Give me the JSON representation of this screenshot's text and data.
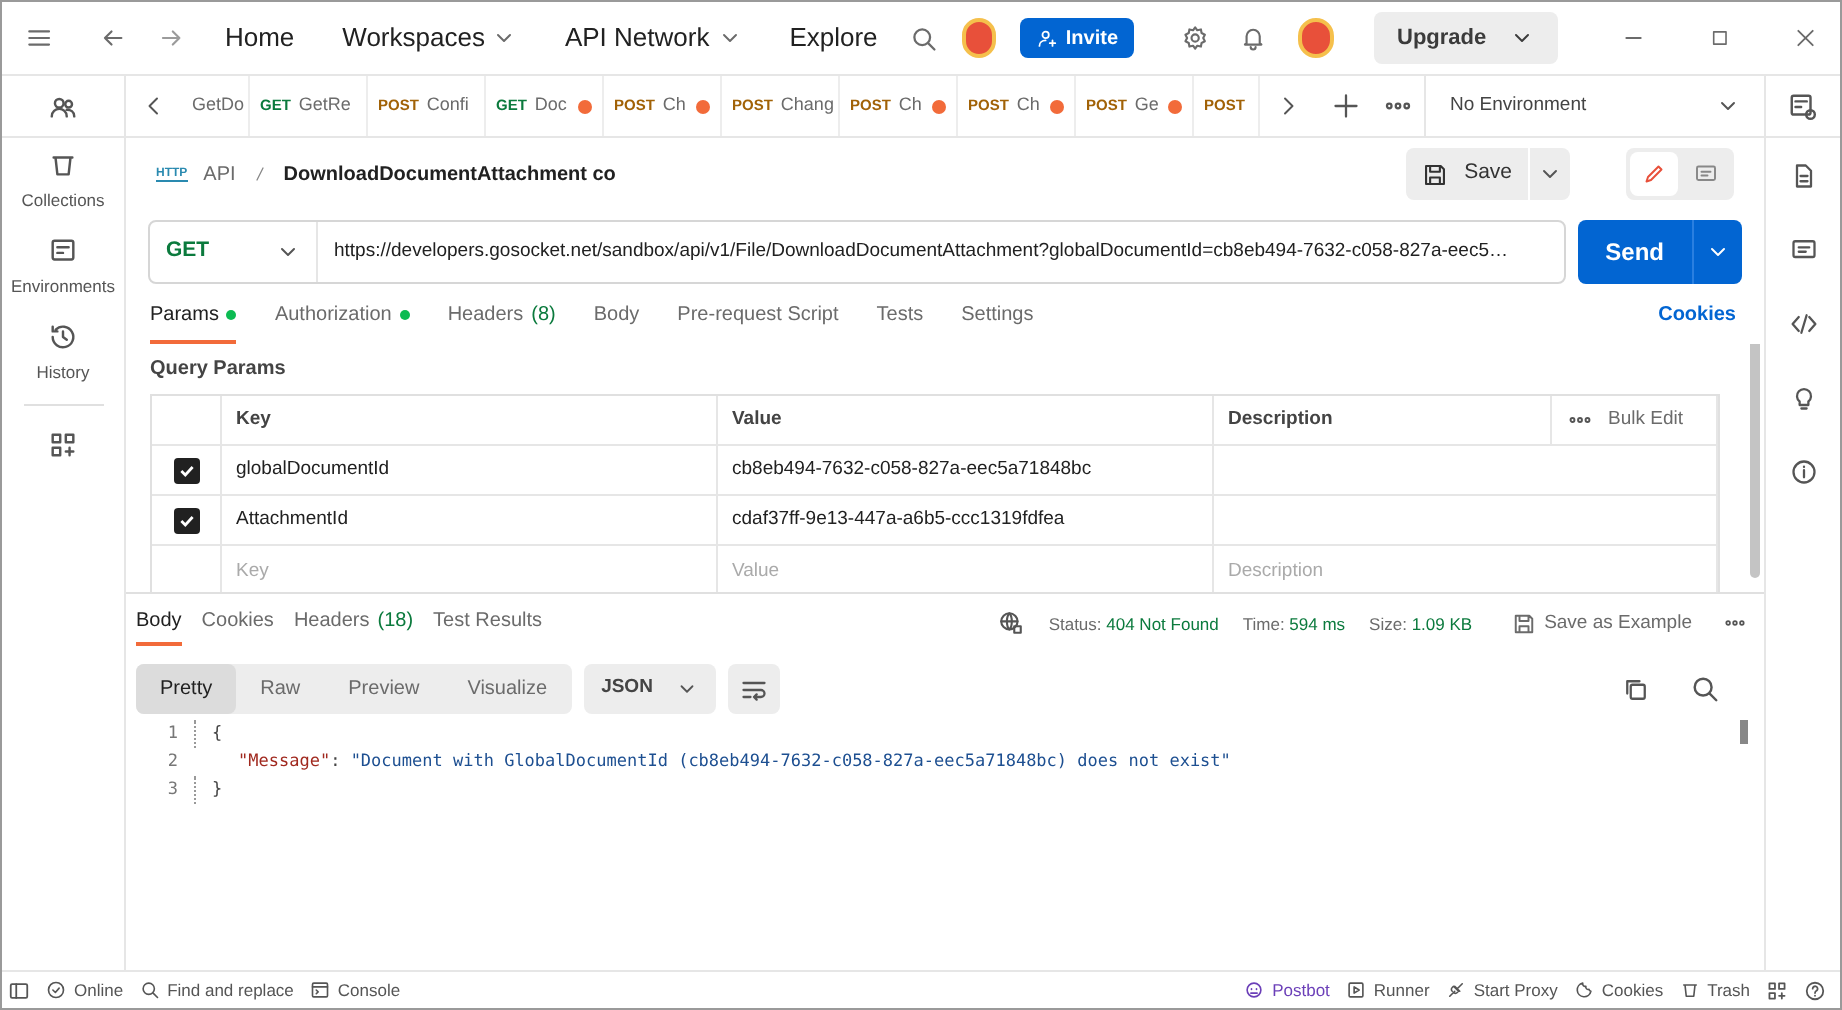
{
  "topbar": {
    "nav": [
      "Home",
      "Workspaces",
      "API Network",
      "Explore"
    ],
    "invite": "Invite",
    "upgrade": "Upgrade"
  },
  "sidebar": [
    {
      "label": "Collections"
    },
    {
      "label": "Environments"
    },
    {
      "label": "History"
    }
  ],
  "tabs": [
    {
      "name": "GetDo",
      "unsaved": false
    },
    {
      "method": "GET",
      "name": "GetRe",
      "unsaved": false
    },
    {
      "method": "POST",
      "name": "Confi",
      "unsaved": false
    },
    {
      "method": "GET",
      "name": "Doc",
      "unsaved": true
    },
    {
      "method": "POST",
      "name": "Ch",
      "unsaved": true
    },
    {
      "method": "POST",
      "name": "Chang",
      "unsaved": false
    },
    {
      "method": "POST",
      "name": "Ch",
      "unsaved": true
    },
    {
      "method": "POST",
      "name": "Ch",
      "unsaved": true
    },
    {
      "method": "POST",
      "name": "Ge",
      "unsaved": true
    },
    {
      "method": "POST",
      "unsaved": false
    }
  ],
  "environment": "No Environment",
  "breadcrumb": {
    "badge": "HTTP",
    "parent": "API",
    "name": "DownloadDocumentAttachment co"
  },
  "save": "Save",
  "request": {
    "method": "GET",
    "url": "https://developers.gosocket.net/sandbox/api/v1/File/DownloadDocumentAttachment?globalDocumentId=cb8eb494-7632-c058-827a-eec5…",
    "send": "Send"
  },
  "request_tabs": [
    {
      "label": "Params",
      "dot": true,
      "selected": true
    },
    {
      "label": "Authorization",
      "dot": true,
      "selected": false
    },
    {
      "label": "Headers",
      "count": "(8)",
      "dot": false,
      "selected": false
    },
    {
      "label": "Body",
      "dot": false,
      "selected": false
    },
    {
      "label": "Pre-request Script",
      "dot": false,
      "selected": false
    },
    {
      "label": "Tests",
      "dot": false,
      "selected": false
    },
    {
      "label": "Settings",
      "dot": false,
      "selected": false
    }
  ],
  "cookies_link": "Cookies",
  "query_params": {
    "title": "Query Params",
    "columns": [
      "Key",
      "Value",
      "Description"
    ],
    "bulk_edit": "Bulk Edit",
    "rows": [
      {
        "checked": true,
        "key": "globalDocumentId",
        "value": "cb8eb494-7632-c058-827a-eec5a71848bc"
      },
      {
        "checked": true,
        "key": "AttachmentId",
        "value": "cdaf37ff-9e13-447a-a6b5-ccc1319fdfea"
      }
    ],
    "placeholders": [
      "Key",
      "Value",
      "Description"
    ]
  },
  "response_tabs": [
    {
      "label": "Body",
      "selected": true
    },
    {
      "label": "Cookies",
      "selected": false
    },
    {
      "label": "Headers",
      "count": "(18)",
      "selected": false
    },
    {
      "label": "Test Results",
      "selected": false
    }
  ],
  "response_meta": [
    {
      "label": "Status:",
      "value": "404 Not Found"
    },
    {
      "label": "Time:",
      "value": "594 ms"
    },
    {
      "label": "Size:",
      "value": "1.09 KB"
    }
  ],
  "save_example": "Save as Example",
  "view_modes": [
    {
      "label": "Pretty",
      "selected": true
    },
    {
      "label": "Raw",
      "selected": false
    },
    {
      "label": "Preview",
      "selected": false
    },
    {
      "label": "Visualize",
      "selected": false
    }
  ],
  "format": "JSON",
  "code": [
    {
      "n": "1",
      "text": "{"
    },
    {
      "n": "2",
      "key": "\"Message\"",
      "sep": ":",
      "text": "\"Document with GlobalDocumentId (cb8eb494-7632-c058-827a-eec5a71848bc) does not exist\""
    },
    {
      "n": "3",
      "text": "}"
    }
  ],
  "status_bar": {
    "left": [
      "Online",
      "Find and replace",
      "Console"
    ],
    "right": [
      "Postbot",
      "Runner",
      "Start Proxy",
      "Cookies",
      "Trash"
    ]
  }
}
